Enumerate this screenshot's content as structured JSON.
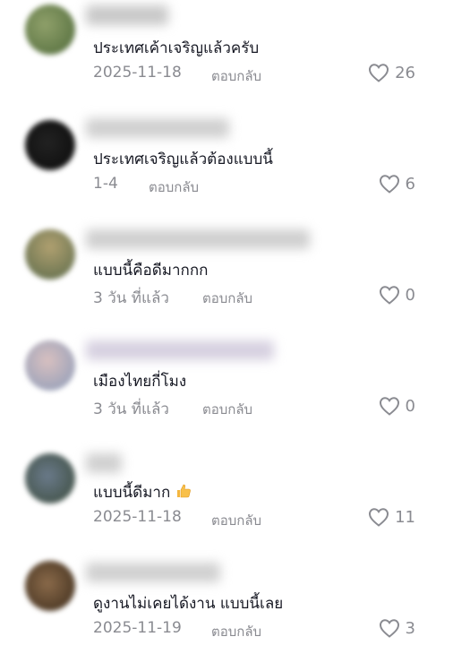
{
  "comments": [
    {
      "text": "ประเทศเค้าเจริญแล้วครับ",
      "date": "2025-11-18",
      "reply": "ตอบกลับ",
      "likes": "26"
    },
    {
      "text": "ประเทศเจริญแล้วต้องแบบนี้",
      "date": "1-4",
      "reply": "ตอบกลับ",
      "likes": "6"
    },
    {
      "text": "แบบนี้คือดีมากกก",
      "date": "3 วัน ที่แล้ว",
      "reply": "ตอบกลับ",
      "likes": "0"
    },
    {
      "text": "เมืองไทยกี่โมง",
      "date": "3 วัน ที่แล้ว",
      "reply": "ตอบกลับ",
      "likes": "0"
    },
    {
      "text": "แบบนี้ดีมาก",
      "date": "2025-11-18",
      "reply": "ตอบกลับ",
      "likes": "11"
    },
    {
      "text": "ดูงานไม่เคยได้งาน แบบนี้เลย",
      "date": "2025-11-19",
      "reply": "ตอบกลับ",
      "likes": "3"
    }
  ],
  "colors": {
    "text": "#161823",
    "muted": "#8a8b91"
  },
  "icons": {
    "like": "heart-outline-icon",
    "emoji": "thumbs-up-emoji-icon"
  }
}
